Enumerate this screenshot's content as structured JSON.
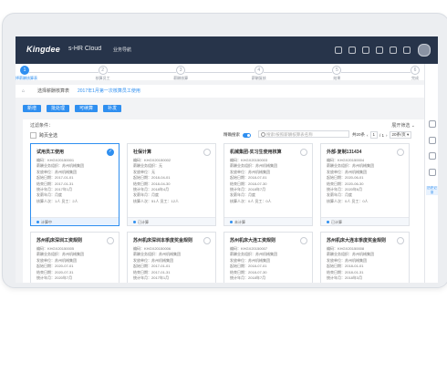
{
  "app": {
    "brand": "Kingdee",
    "product": "s-HR Cloud",
    "menu": "业务导航"
  },
  "stepper": [
    {
      "num": "1",
      "label": "选择薪酬核算表",
      "active": true
    },
    {
      "num": "2",
      "label": "核算员工",
      "active": false
    },
    {
      "num": "3",
      "label": "薪酬核算",
      "active": false
    },
    {
      "num": "4",
      "label": "薪酬复核",
      "active": false
    },
    {
      "num": "5",
      "label": "结果",
      "active": false
    },
    {
      "num": "6",
      "label": "完成",
      "active": false
    }
  ],
  "breadcrumb": {
    "home": "⌂",
    "level1": "选择薪酬核算表",
    "level2": "2017年1月第一次核算员工使用"
  },
  "actions": [
    "新增",
    "批处理",
    "可续算",
    "补发"
  ],
  "toolbar": {
    "filter_label": "过滤条件：",
    "collapse_label": "展开筛选 ⌄",
    "select_page": "跨页全选",
    "precise_label": "精确搜索",
    "search_placeholder": "搜索/按照薪酬核算表名称",
    "pager_text": "共20条",
    "page_current": "1",
    "page_total": "/ 1",
    "page_size": "20条/页 ▾"
  },
  "cards": [
    {
      "title": "试用员工使用",
      "selected": true,
      "status": "计算中",
      "fields": [
        "编码：KHGX20150001",
        "薪酬业务组织：苏州机械集团",
        "发放单位：苏州机械集团",
        "起始日期：2017-01-01",
        "结束日期：2017-01-31",
        "统计年月：2017年1月",
        "发薪年月：月度",
        "核算人次：1人    员工：2人"
      ]
    },
    {
      "title": "社保计算",
      "selected": false,
      "status": "已计算",
      "fields": [
        "编码：KHGX20150002",
        "薪酬业务组织：无",
        "发放单位：无",
        "起始日期：2018-04-01",
        "结束日期：2018-04-30",
        "统计年月：2018年4月",
        "发薪年月：月度",
        "核算人次：51人    员工：12人"
      ]
    },
    {
      "title": "机械集团-实习生使用核算",
      "selected": false,
      "status": "未计算",
      "fields": [
        "编码：KHGX20150003",
        "薪酬业务组织：苏州机械集团",
        "发放单位：苏州机械集团",
        "起始日期：2018-07-01",
        "结束日期：2018-07-30",
        "统计年月：2018年7月",
        "发薪年月：月度",
        "核算人次：0人    员工：0人"
      ]
    },
    {
      "title": "外部-复制131434",
      "selected": false,
      "status": "已计算",
      "fields": [
        "编码：KHGX20150004",
        "薪酬业务组织：苏州机械集团",
        "发放单位：苏州机械集团",
        "起始日期：2020-06-01",
        "结束日期：2020-06-30",
        "统计年月：2020年6月",
        "发薪年月：月度",
        "核算人次：0人    员工：0人"
      ]
    },
    {
      "title": "苏州机床深圳工资规则",
      "selected": false,
      "status": "",
      "fields": [
        "编码：KHGX20150005",
        "薪酬业务组织：苏州机械集团",
        "发放单位：苏州机械集团",
        "起始日期：2020-07-01",
        "结束日期：2020-07-31",
        "统计年月：2020年7月"
      ]
    },
    {
      "title": "苏州机床深圳本季度奖金规则",
      "selected": false,
      "status": "",
      "fields": [
        "编码：KHGX20150006",
        "薪酬业务组织：苏州机械集团",
        "发放单位：苏州机械集团",
        "起始日期：2017-01-01",
        "结束日期：2017-01-31",
        "统计年月：2017年1月"
      ]
    },
    {
      "title": "苏州机床大连工资规则",
      "selected": false,
      "status": "",
      "fields": [
        "编码：KHGX20150007",
        "薪酬业务组织：苏州机械集团",
        "发放单位：苏州机械集团",
        "起始日期：2018-07-01",
        "结束日期：2018-07-30",
        "统计年月：2018年7月"
      ]
    },
    {
      "title": "苏州机床大连本季度奖金规则",
      "selected": false,
      "status": "",
      "fields": [
        "编码：KHGX20150008",
        "薪酬业务组织：苏州机械集团",
        "发放单位：苏州机械集团",
        "起始日期：2018-01-01",
        "结束日期：2018-01-31",
        "统计年月：2018年3月"
      ]
    }
  ],
  "rail": {
    "label": "历史记录"
  }
}
